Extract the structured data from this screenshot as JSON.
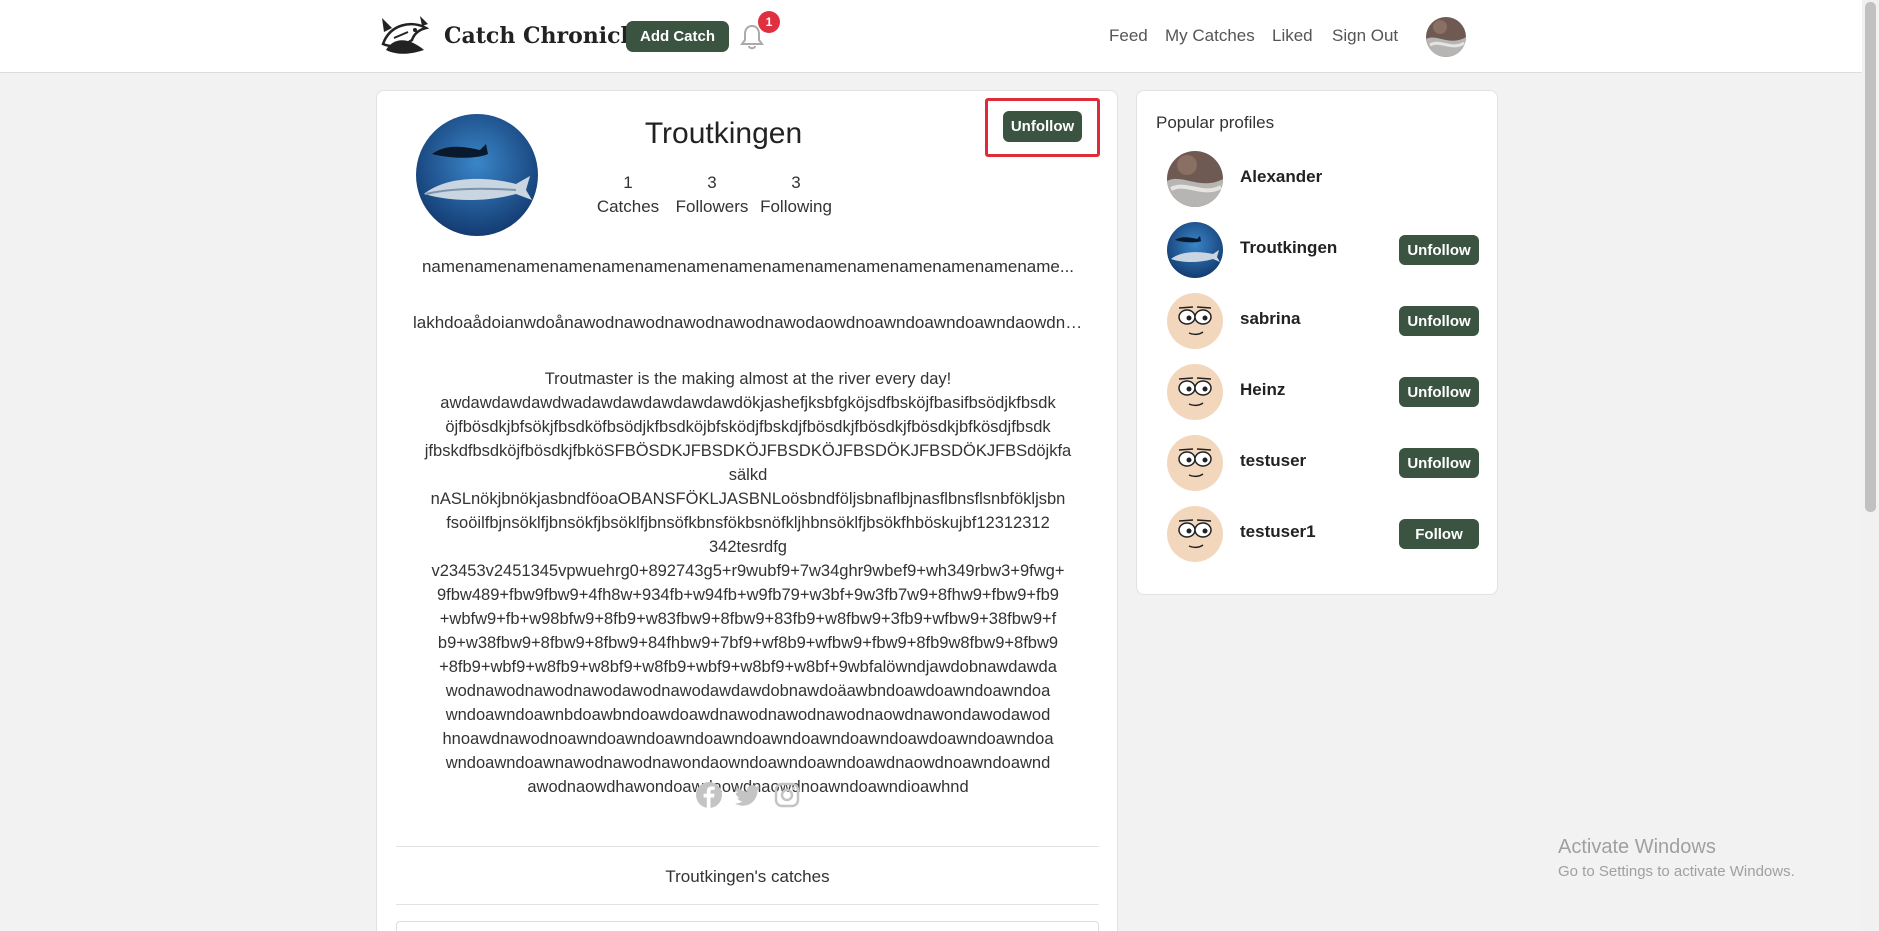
{
  "header": {
    "brand": "Catch Chronicle",
    "add_catch_label": "Add Catch",
    "notification_count": "1",
    "nav": {
      "feed": "Feed",
      "my_catches": "My Catches",
      "liked": "Liked",
      "sign_out": "Sign Out"
    }
  },
  "profile": {
    "name": "Troutkingen",
    "stats": [
      {
        "value": "1",
        "label": "Catches"
      },
      {
        "value": "3",
        "label": "Followers"
      },
      {
        "value": "3",
        "label": "Following"
      }
    ],
    "unfollow_label": "Unfollow",
    "line1": "namenamenamenamenamenamenamenamenamenamenamenamenamenamename...",
    "line2": "lakhdoaådoianwdoånawodnawodnawodnawodnawodaowdnoawndoawndoawndaowdnoaw...",
    "bio_lines": [
      "Troutmaster is the making almost at the river every day!",
      "awdawdawdawdwadawdawdawdawdawdökjashefjksbfgköjsdfbsköjfbasifbsödjkfbsdk",
      "öjfbösdkjbfsökjfbsdköfbsödjkfbsdköjbfsködjfbskdjfbösdkjfbösdkjfbösdkjbfkösdjfbsdk",
      "jfbskdfbsdköjfbösdkjfbköSFBÖSDKJFBSDKÖJFBSDKÖJFBSDÖKJFBSDÖKJFBSdöjkfasälkd",
      "nASLnökjbnökjasbndföoaOBANSFÖKLJASBNLoösbndföljsbnaflbjnasflbnsflsnbfökljsbn",
      "fsoöilfbjnsöklfjbnsökfjbsöklfjbnsöfkbnsfökbsnöfkljhbnsöklfjbsökfhböskujbf12312312",
      "342tesrdfg",
      "v23453v2451345vpwuehrg0+892743g5+r9wubf9+7w34ghr9wbef9+wh349rbw3+9fwg+",
      "9fbw489+fbw9fbw9+4fh8w+934fb+w94fb+w9fb79+w3bf+9w3fb7w9+8fhw9+fbw9+fb9",
      "+wbfw9+fb+w98bfw9+8fb9+w83fbw9+8fbw9+83fb9+w8fbw9+3fb9+wfbw9+38fbw9+f",
      "b9+w38fbw9+8fbw9+8fbw9+84fhbw9+7bf9+wf8b9+wfbw9+fbw9+8fb9w8fbw9+8fbw9",
      "+8fb9+wbf9+w8fb9+w8bf9+w8fb9+wbf9+w8bf9+w8bf+9wbfalöwndjawdobnawdawda",
      "wodnawodnawodnawodawodnawodawdawdobnawdoäawbndoawdoawndoawndoa",
      "wndoawndoawnbdoawbndoawdoawdnawodnawodnawodnaowdnawondawodawod",
      "hnoawdnawodnoawndoawndoawndoawndoawndoawndoawndoawdoawndoawndoa",
      "wndoawndoawnawodnawodnawondaowndoawndoawndoawdnaowdnoawndoawnd",
      "awodnaowdhawondoawdaowdnaowdnoawndoawndioawhnd"
    ],
    "catches_heading": "Troutkingen's catches"
  },
  "popular": {
    "title": "Popular profiles",
    "profiles": [
      {
        "name": "Alexander",
        "button": ""
      },
      {
        "name": "Troutkingen",
        "button": "Unfollow"
      },
      {
        "name": "sabrina",
        "button": "Unfollow"
      },
      {
        "name": "Heinz",
        "button": "Unfollow"
      },
      {
        "name": "testuser",
        "button": "Unfollow"
      },
      {
        "name": "testuser1",
        "button": "Follow"
      }
    ]
  },
  "watermark": {
    "title": "Activate Windows",
    "subtitle": "Go to Settings to activate Windows."
  },
  "colors": {
    "accent": "#3b5441",
    "badge": "#e0303f",
    "highlight": "#e02c3a"
  },
  "icons": [
    "fish-logo-icon",
    "bell-icon",
    "facebook-icon",
    "twitter-icon",
    "instagram-icon"
  ]
}
